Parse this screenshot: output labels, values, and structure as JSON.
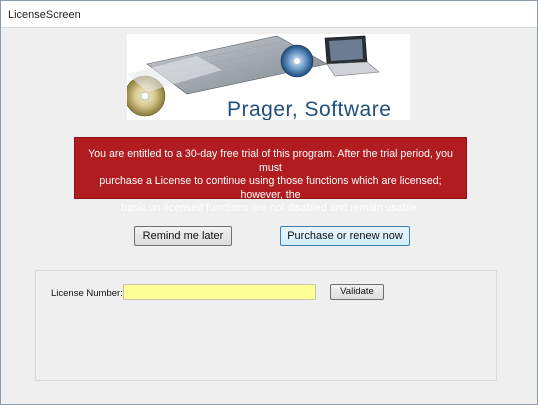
{
  "window": {
    "title": "LicenseScreen"
  },
  "logo": {
    "text": "Prager, Software"
  },
  "notice": {
    "line1": "You are entitled to a 30-day free trial of this program.  After the trial period, you must",
    "line2": "purchase a License to continue using those functions which are licensed; however, the",
    "line3": "basic un-licensed functions are not disabled and remain usable.",
    "background_color": "#b01c20"
  },
  "buttons": {
    "remind_label": "Remind me later",
    "purchase_label": "Purchase or renew now"
  },
  "license": {
    "label": "License Number:",
    "value": "",
    "field_color": "#ffff99",
    "validate_label": "Validate"
  }
}
